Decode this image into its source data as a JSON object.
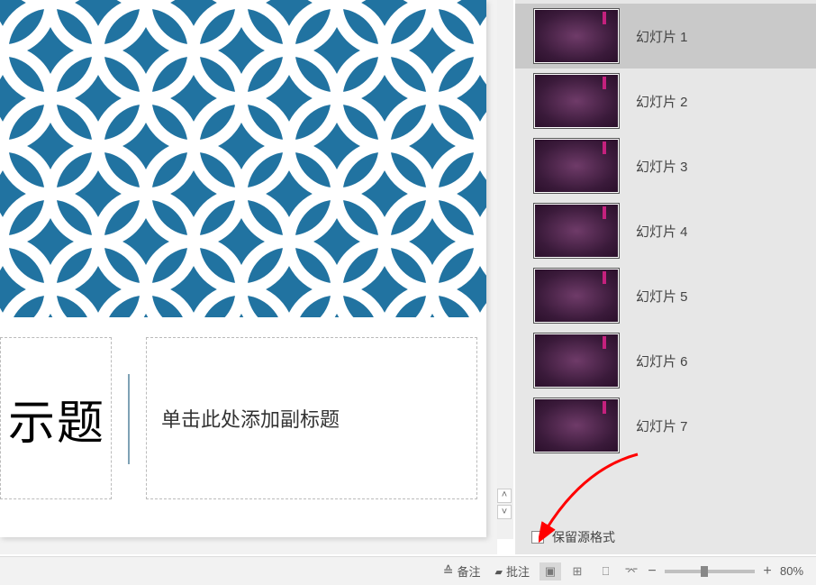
{
  "slide": {
    "title_fragment": "示题",
    "subtitle_placeholder": "单击此处添加副标题"
  },
  "reuse_panel": {
    "items": [
      {
        "label": "幻灯片 1",
        "selected": true
      },
      {
        "label": "幻灯片 2",
        "selected": false
      },
      {
        "label": "幻灯片 3",
        "selected": false
      },
      {
        "label": "幻灯片 4",
        "selected": false
      },
      {
        "label": "幻灯片 5",
        "selected": false
      },
      {
        "label": "幻灯片 6",
        "selected": false
      },
      {
        "label": "幻灯片 7",
        "selected": false
      }
    ],
    "keep_source_formatting": "保留源格式"
  },
  "status": {
    "notes": "备注",
    "comments": "批注",
    "zoom_minus": "−",
    "zoom_plus": "+",
    "zoom_pct": "80%"
  },
  "colors": {
    "pattern_bg": "#2173a1",
    "thumb_gradient_inner": "#6f3b69",
    "thumb_gradient_outer": "#2a0f2a",
    "arrow": "#ff0000"
  }
}
